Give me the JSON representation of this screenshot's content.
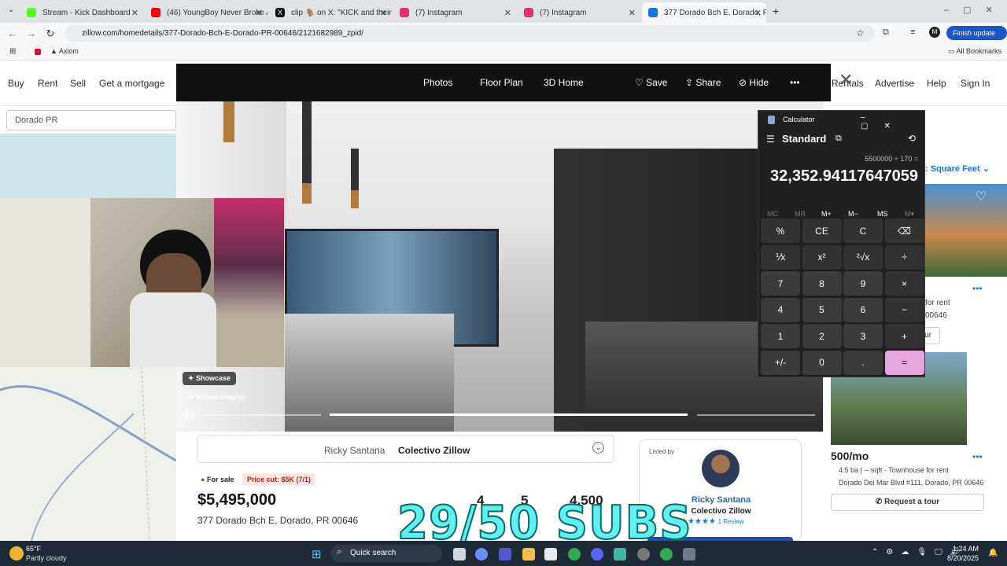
{
  "browser": {
    "tabs": [
      {
        "title": "Stream - Kick Dashboard",
        "color": "#53fc18"
      },
      {
        "title": "(46) YoungBoy Never Broke Ag",
        "color": "#ff0000"
      },
      {
        "title": "clip 🐐 on X: \"KICK and their n",
        "color": "#111111"
      },
      {
        "title": "(7) Instagram",
        "color": "#e1306c"
      },
      {
        "title": "(7) Instagram",
        "color": "#e1306c"
      },
      {
        "title": "377 Dorado Bch E, Dorado, PR",
        "color": "#1277e1"
      }
    ],
    "url": "zillow.com/homedetails/377-Dorado-Bch-E-Dorado-PR-00646/2121682989_zpid/",
    "finish_update": "Finish update",
    "bookmarks": {
      "axiom": "Axiom",
      "all": "All Bookmarks"
    }
  },
  "zillow": {
    "nav_left": [
      "Buy",
      "Rent",
      "Sell",
      "Get a mortgage"
    ],
    "nav_right": [
      "Rentals",
      "Advertise",
      "Help",
      "Sign In"
    ],
    "search_value": "Dorado PR",
    "sort_label": "Square Feet"
  },
  "modal": {
    "tabs": [
      "Photos",
      "Floor Plan",
      "3D Home"
    ],
    "save": "Save",
    "share": "Share",
    "hide": "Hide",
    "showcase": "Showcase",
    "virtual_staging": "Virtual staging"
  },
  "listing": {
    "agent_team": "Ricky Santana",
    "brokerage": "Colectivo Zillow",
    "status": "For sale",
    "price_cut": "Price cut: $5K (7/1)",
    "price": "$5,495,000",
    "address": "377 Dorado Bch E, Dorado, PR 00646",
    "beds": "4",
    "baths": "5",
    "sqft": "4,500",
    "listed_by": "Listed by",
    "agent_name": "Ricky Santana",
    "agent_company": "Colectivo Zillow",
    "reviews": "1 Review",
    "rating": 5
  },
  "right_cards": {
    "card1_type": "for rent",
    "card1_zip": "00646",
    "card1_btn": "ur",
    "card2_price": "500/mo",
    "card2_details": "4.5 ba | -- sqft - Townhouse for rent",
    "card2_address": "Dorado Del Mar Blvd #111, Dorado, PR 00646",
    "card2_btn": "Request a tour"
  },
  "calculator": {
    "title": "Calculator",
    "mode": "Standard",
    "expression": "5500000 ÷ 170 =",
    "result": "32,352.94117647059",
    "memory": [
      "MC",
      "MR",
      "M+",
      "M−",
      "MS",
      "M▾"
    ],
    "keys": [
      [
        "%",
        "CE",
        "C",
        "⌫"
      ],
      [
        "⅟x",
        "x²",
        "²√x",
        "÷"
      ],
      [
        "7",
        "8",
        "9",
        "×"
      ],
      [
        "4",
        "5",
        "6",
        "−"
      ],
      [
        "1",
        "2",
        "3",
        "+"
      ],
      [
        "+/-",
        "0",
        ".",
        "="
      ]
    ]
  },
  "overlay": {
    "subs": "29/50 SUBS"
  },
  "taskbar": {
    "weather_temp": "65°F",
    "weather_desc": "Partly cloudy",
    "search": "Quick search",
    "time": "1:24 AM",
    "date": "8/20/2025"
  }
}
